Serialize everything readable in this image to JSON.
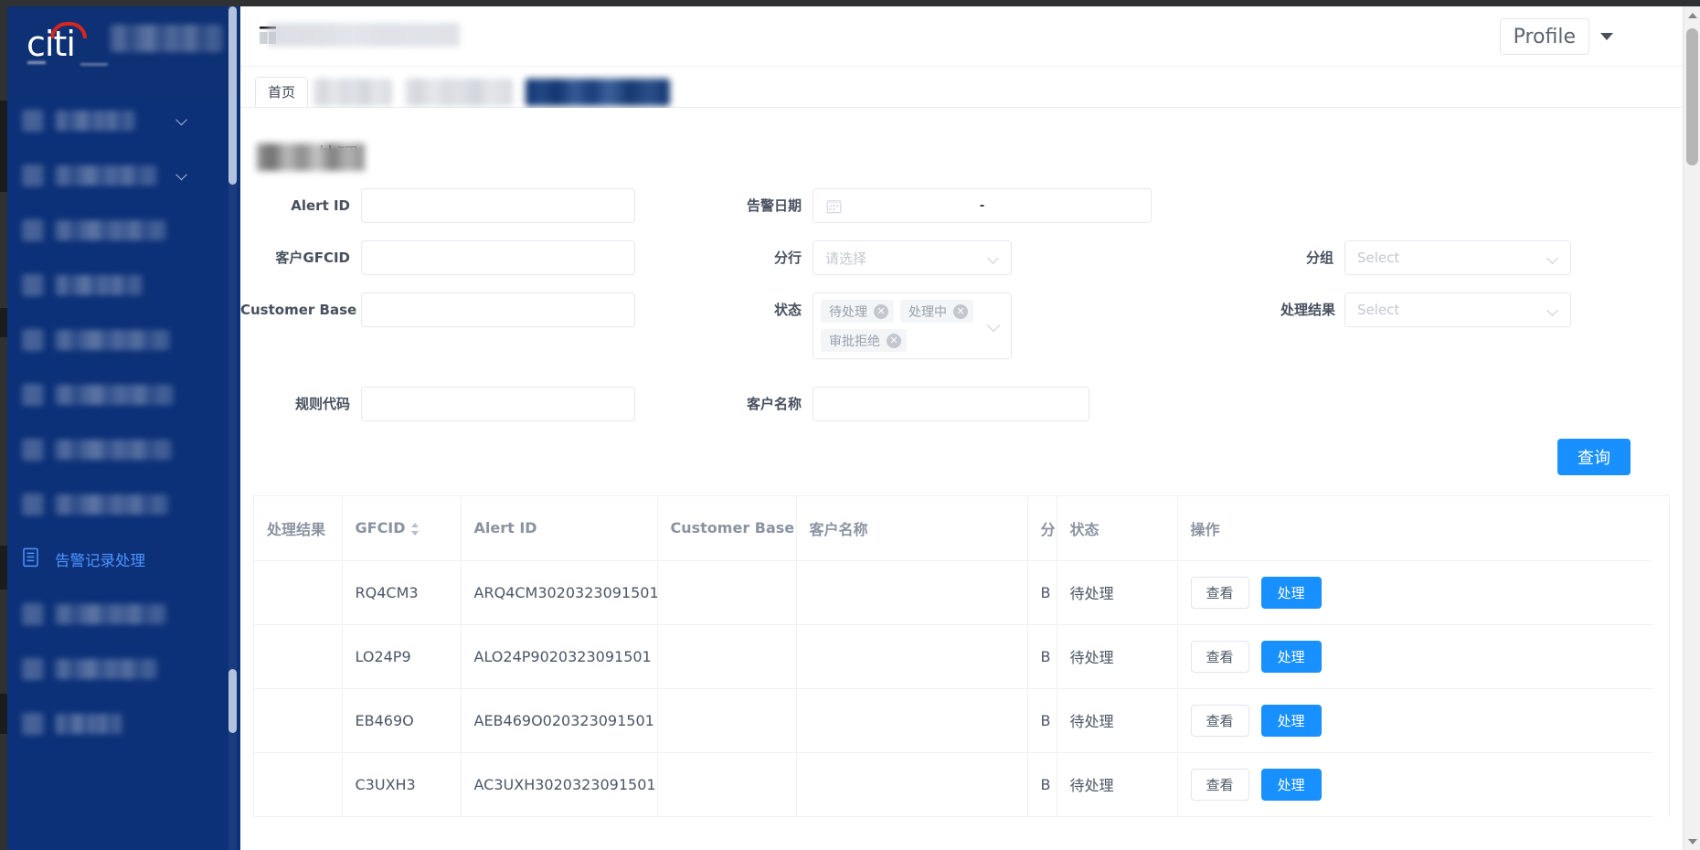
{
  "window": {
    "accent_blue": "#1890ff",
    "sidebar_bg": "#0d3178",
    "brand_red": "#d9261c"
  },
  "brand": {
    "logo_text": "citi",
    "logo_subtitle_redacted": true
  },
  "header": {
    "title_redacted": true,
    "profile_label": "Profile",
    "menu_icon": "hamburger-grid-icon"
  },
  "tabs": [
    {
      "label": "首页",
      "state": "card",
      "redacted": false
    },
    {
      "label": "",
      "state": "inactive",
      "redacted": true
    },
    {
      "label": "",
      "state": "inactive",
      "redacted": true
    },
    {
      "label": "",
      "state": "active",
      "redacted": true
    }
  ],
  "sidebar": {
    "items": [
      {
        "label": "",
        "redacted": true,
        "expandable": true,
        "active": false
      },
      {
        "label": "",
        "redacted": true,
        "expandable": true,
        "active": false
      },
      {
        "label": "",
        "redacted": true,
        "expandable": false,
        "active": false
      },
      {
        "label": "",
        "redacted": true,
        "expandable": false,
        "active": false
      },
      {
        "label": "",
        "redacted": true,
        "expandable": false,
        "active": false
      },
      {
        "label": "",
        "redacted": true,
        "expandable": false,
        "active": false
      },
      {
        "label": "",
        "redacted": true,
        "expandable": false,
        "active": false
      },
      {
        "label": "",
        "redacted": true,
        "expandable": false,
        "active": false
      },
      {
        "label": "告警记录处理",
        "redacted": false,
        "expandable": false,
        "active": true
      },
      {
        "label": "",
        "redacted": true,
        "expandable": false,
        "active": false
      },
      {
        "label": "",
        "redacted": true,
        "expandable": false,
        "active": false
      },
      {
        "label": "",
        "redacted": true,
        "expandable": false,
        "active": false
      }
    ]
  },
  "page": {
    "title_suffix": "处理",
    "title_redacted_prefix": true
  },
  "form": {
    "alert_id": {
      "label": "Alert ID",
      "value": "",
      "placeholder": ""
    },
    "alert_date": {
      "label": "告警日期",
      "value": "",
      "separator": "-",
      "icon": "calendar-icon"
    },
    "gfcid": {
      "label": "客户GFCID",
      "value": "",
      "placeholder": ""
    },
    "branch": {
      "label": "分行",
      "value": "",
      "placeholder": "请选择"
    },
    "group": {
      "label": "分组",
      "value": "",
      "placeholder": "Select"
    },
    "customer_base": {
      "label": "Customer Base",
      "value": "",
      "placeholder": ""
    },
    "status": {
      "label": "状态",
      "tags": [
        "待处理",
        "处理中",
        "审批拒绝"
      ],
      "remove_glyph": "✕"
    },
    "process_result": {
      "label": "处理结果",
      "value": "",
      "placeholder": "Select"
    },
    "rule_code": {
      "label": "规则代码",
      "value": "",
      "placeholder": ""
    },
    "customer_name": {
      "label": "客户名称",
      "value": "",
      "placeholder": ""
    },
    "search_button": "查询"
  },
  "table": {
    "columns": [
      {
        "key": "process_result",
        "label": "处理结果",
        "sortable": false
      },
      {
        "key": "gfcid",
        "label": "GFCID",
        "sortable": true
      },
      {
        "key": "alert_id",
        "label": "Alert ID",
        "sortable": false
      },
      {
        "key": "customer_base",
        "label": "Customer Base",
        "sortable": false
      },
      {
        "key": "customer_name",
        "label": "客户名称",
        "sortable": false
      },
      {
        "key": "branch",
        "label": "分",
        "sortable": false
      },
      {
        "key": "status",
        "label": "状态",
        "sortable": false
      },
      {
        "key": "actions",
        "label": "操作",
        "sortable": false
      }
    ],
    "rows": [
      {
        "process_result": "",
        "gfcid": "RQ4CM3",
        "alert_id": "ARQ4CM3020323091501",
        "customer_base": "",
        "customer_name": "",
        "branch": "B",
        "status": "待处理",
        "view_label": "查看",
        "action_label": "处理"
      },
      {
        "process_result": "",
        "gfcid": "LO24P9",
        "alert_id": "ALO24P9020323091501",
        "customer_base": "",
        "customer_name": "",
        "branch": "B",
        "status": "待处理",
        "view_label": "查看",
        "action_label": "处理"
      },
      {
        "process_result": "",
        "gfcid": "EB469O",
        "alert_id": "AEB469O020323091501",
        "customer_base": "",
        "customer_name": "",
        "branch": "B",
        "status": "待处理",
        "view_label": "查看",
        "action_label": "处理"
      },
      {
        "process_result": "",
        "gfcid": "C3UXH3",
        "alert_id": "AC3UXH3020323091501",
        "customer_base": "",
        "customer_name": "",
        "branch": "B",
        "status": "待处理",
        "view_label": "查看",
        "action_label": "处理"
      }
    ]
  },
  "scrollbars": {
    "page_vertical_visible": true,
    "sidebar_vertical_visible": true
  }
}
